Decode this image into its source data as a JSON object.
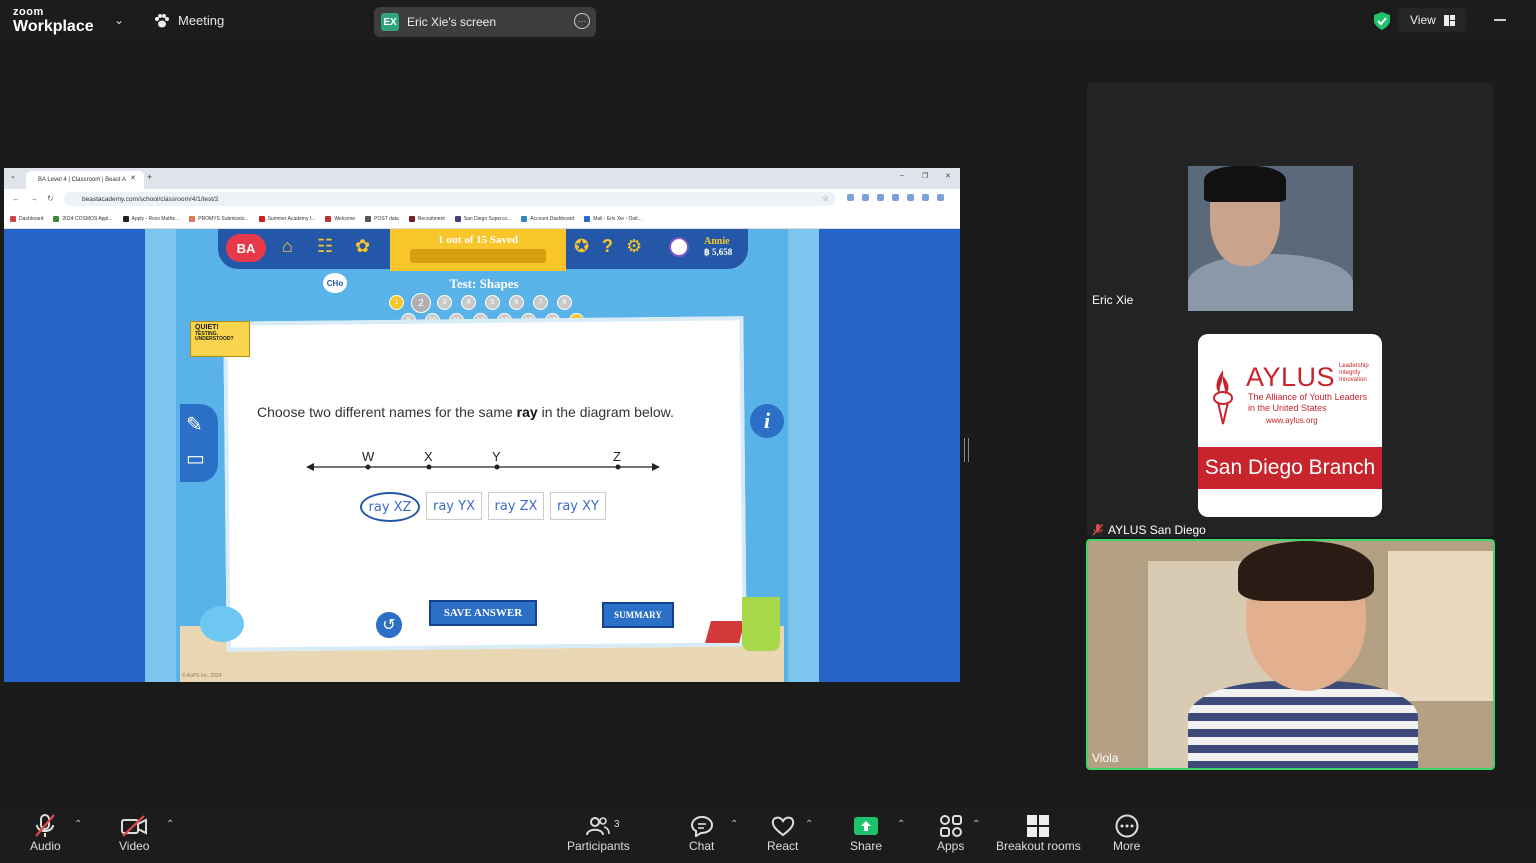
{
  "app": {
    "brand_top": "zoom",
    "brand_bottom": "Workplace",
    "meeting_label": "Meeting",
    "screen_label": "Eric Xie's screen",
    "screen_initials": "EX",
    "view_label": "View"
  },
  "browser": {
    "tab_title": "BA Level 4 | Classroom | Beast A",
    "url": "beastacademy.com/school/classroom/4/1/test/2",
    "bookmarks": [
      "Dashboard",
      "2024 COSMOS Appl...",
      "Apply - Ross Mathe...",
      "PROMYS Submissio...",
      "Summer Academy f...",
      "Welcome",
      "POST data",
      "Recruitment",
      "San Diego Superco...",
      "Account Dashboard",
      "Mail - Eric Xie - Outl..."
    ]
  },
  "game": {
    "logo": "BA",
    "saved_status": "1 out of 15 Saved",
    "user_name": "Annie",
    "user_coins": "฿ 5,658",
    "chapter_badge": "CHo",
    "test_title": "Test: Shapes",
    "questions_row1": [
      "1",
      "2",
      "3",
      "4",
      "5",
      "6",
      "7",
      "8"
    ],
    "questions_row2": [
      "9",
      "10",
      "11",
      "12",
      "13",
      "14",
      "15"
    ],
    "quiet_sign": {
      "line1": "QUIET!",
      "line2": "TESTING.",
      "line3": "UNDERSTOOD?"
    },
    "question_prefix": "Choose two different names for the same ",
    "question_bold": "ray",
    "question_suffix": " in the diagram below.",
    "points": [
      "W",
      "X",
      "Y",
      "Z"
    ],
    "answers": [
      "ray XZ",
      "ray YX",
      "ray ZX",
      "ray XY"
    ],
    "save_button": "SAVE ANSWER",
    "summary_button": "SUMMARY",
    "info_icon": "i",
    "copyright": "© AoPS Inc. 2024"
  },
  "participants": {
    "eric": "Eric Xie",
    "aylus": "AYLUS San Diego",
    "viola": "Viola"
  },
  "aylus_card": {
    "title": "AYLUS",
    "tagline": [
      "Leadership",
      "Integrity",
      "Innovation"
    ],
    "line1": "The Alliance of Youth Leaders",
    "line2": "in the United States",
    "url": "www.aylus.org",
    "branch": "San Diego Branch"
  },
  "toolbar": {
    "audio": "Audio",
    "video": "Video",
    "participants": "Participants",
    "participants_count": "3",
    "chat": "Chat",
    "react": "React",
    "share": "Share",
    "apps": "Apps",
    "breakout": "Breakout rooms",
    "more": "More"
  },
  "colors": {
    "share_green": "#1ec26a",
    "speaker_border": "#3dd66b",
    "aylus_red": "#c8242c"
  }
}
